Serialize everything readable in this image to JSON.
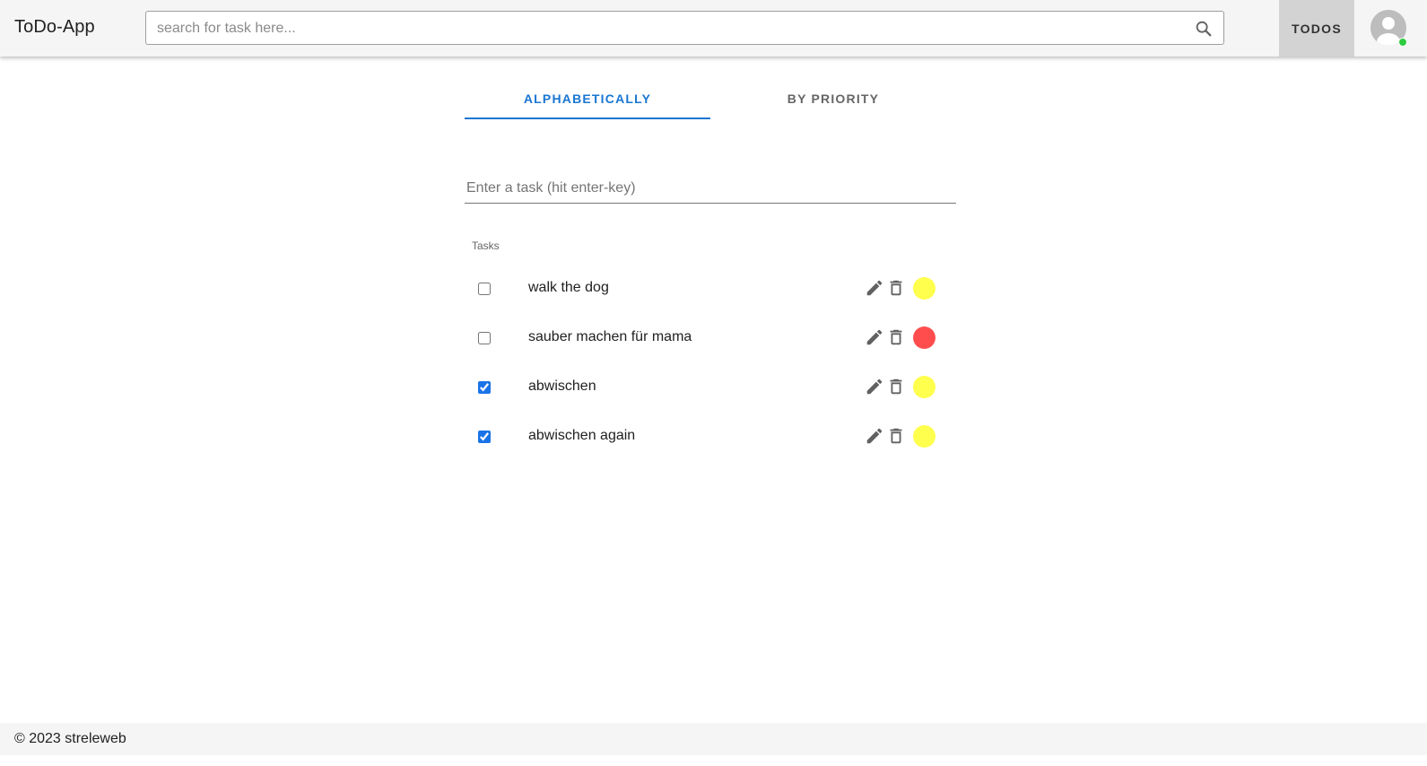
{
  "header": {
    "app_title": "ToDo-App",
    "search_placeholder": "search for task here...",
    "search_value": "",
    "todos_label": "TODOS",
    "online_status_color": "#2ecc40"
  },
  "tabs": [
    {
      "label": "ALPHABETICALLY",
      "active": true
    },
    {
      "label": "BY PRIORITY",
      "active": false
    }
  ],
  "task_input": {
    "placeholder": "Enter a task (hit enter-key)",
    "value": ""
  },
  "list": {
    "header": "Tasks",
    "tasks": [
      {
        "label": "walk the dog",
        "done": false,
        "priority_color": "#ffff4d"
      },
      {
        "label": "sauber machen für mama",
        "done": false,
        "priority_color": "#ff4d4d"
      },
      {
        "label": "abwischen",
        "done": true,
        "priority_color": "#ffff4d"
      },
      {
        "label": "abwischen again",
        "done": true,
        "priority_color": "#ffff4d"
      }
    ]
  },
  "icons": {
    "search": "search-icon",
    "edit": "pencil-icon",
    "delete": "trash-icon",
    "avatar": "user-avatar-icon"
  },
  "colors": {
    "accent": "#1976d2",
    "header_bg": "#f5f5f5",
    "todos_button_bg": "#d3d3d3"
  },
  "footer": {
    "text": "© 2023 streleweb"
  }
}
